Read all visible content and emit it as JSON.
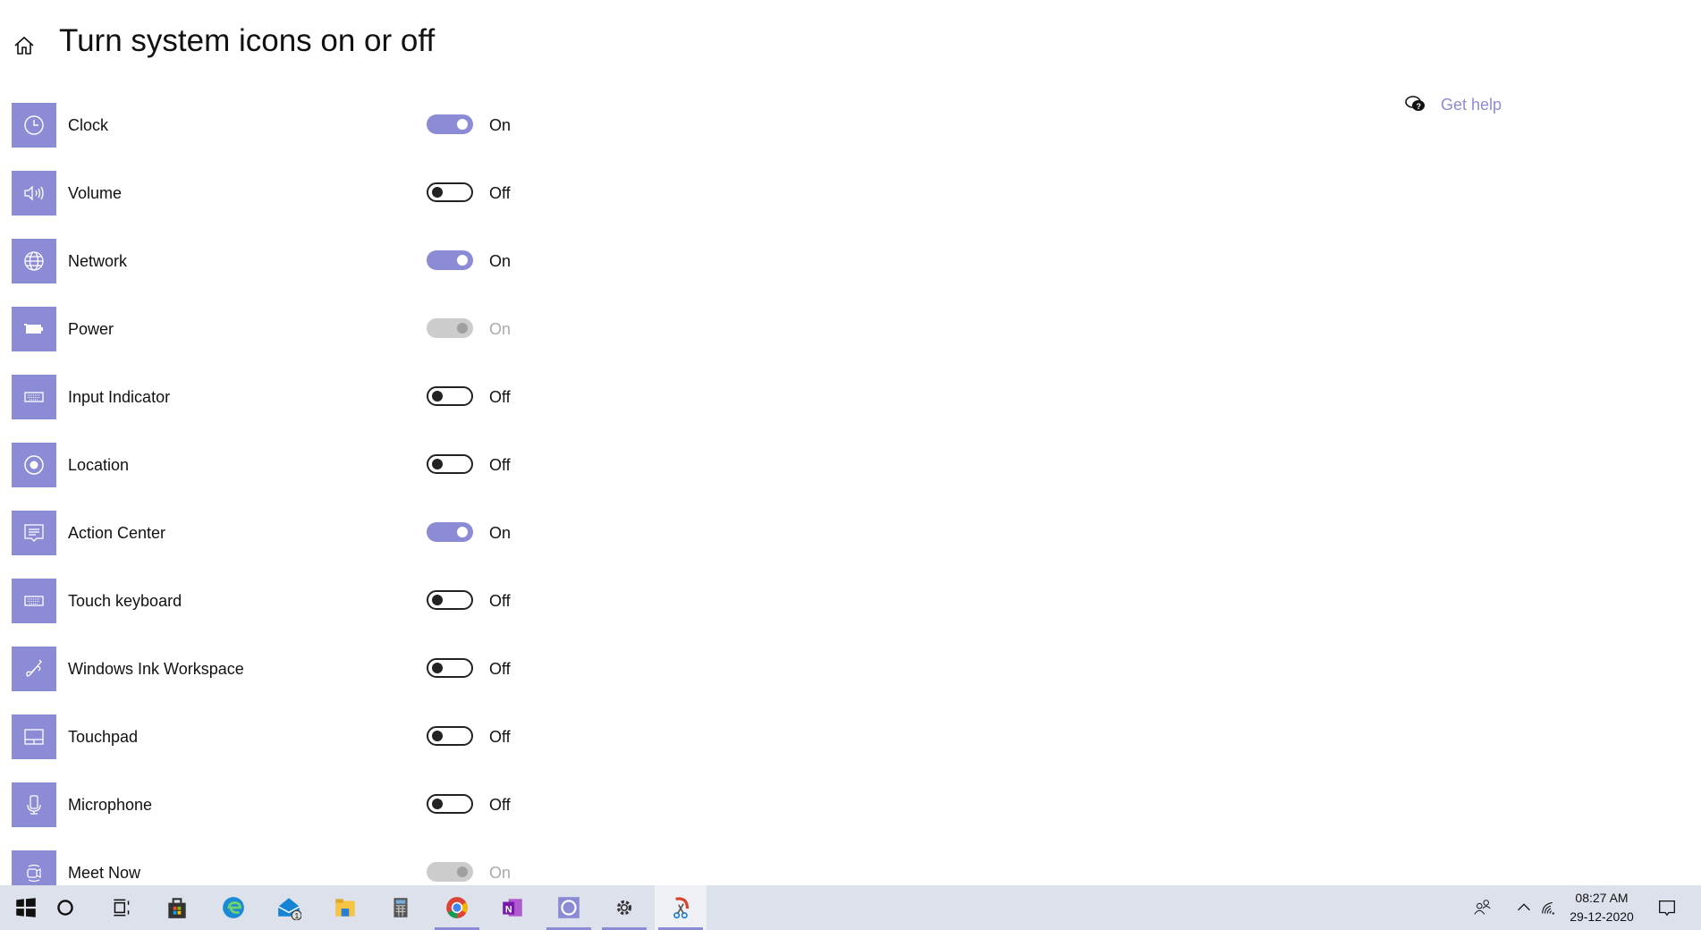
{
  "header": {
    "title": "Turn system icons on or off",
    "home_icon": "home-icon"
  },
  "help": {
    "label": "Get help",
    "icon": "chat-help-icon"
  },
  "colors": {
    "accent": "#8c8bd6",
    "taskbar": "#dce1ec"
  },
  "items": [
    {
      "label": "Clock",
      "icon": "clock-icon",
      "state": "On",
      "mode": "on"
    },
    {
      "label": "Volume",
      "icon": "volume-icon",
      "state": "Off",
      "mode": "off"
    },
    {
      "label": "Network",
      "icon": "globe-icon",
      "state": "On",
      "mode": "on"
    },
    {
      "label": "Power",
      "icon": "battery-icon",
      "state": "On",
      "mode": "dis"
    },
    {
      "label": "Input Indicator",
      "icon": "keyboard-icon",
      "state": "Off",
      "mode": "off"
    },
    {
      "label": "Location",
      "icon": "location-icon",
      "state": "Off",
      "mode": "off"
    },
    {
      "label": "Action Center",
      "icon": "action-center-icon",
      "state": "On",
      "mode": "on"
    },
    {
      "label": "Touch keyboard",
      "icon": "keyboard-icon",
      "state": "Off",
      "mode": "off"
    },
    {
      "label": "Windows Ink Workspace",
      "icon": "pen-icon",
      "state": "Off",
      "mode": "off"
    },
    {
      "label": "Touchpad",
      "icon": "touchpad-icon",
      "state": "Off",
      "mode": "off"
    },
    {
      "label": "Microphone",
      "icon": "microphone-icon",
      "state": "Off",
      "mode": "off"
    },
    {
      "label": "Meet Now",
      "icon": "meet-now-icon",
      "state": "On",
      "mode": "dis"
    }
  ],
  "taskbar": {
    "apps": [
      "start",
      "search",
      "task-view",
      "store",
      "edge",
      "mail",
      "file-explorer",
      "calculator",
      "chrome",
      "onenote",
      "whatsapp",
      "settings",
      "snip-sketch"
    ],
    "mail_badge": "1",
    "time": "08:27 AM",
    "date": "29-12-2020"
  }
}
